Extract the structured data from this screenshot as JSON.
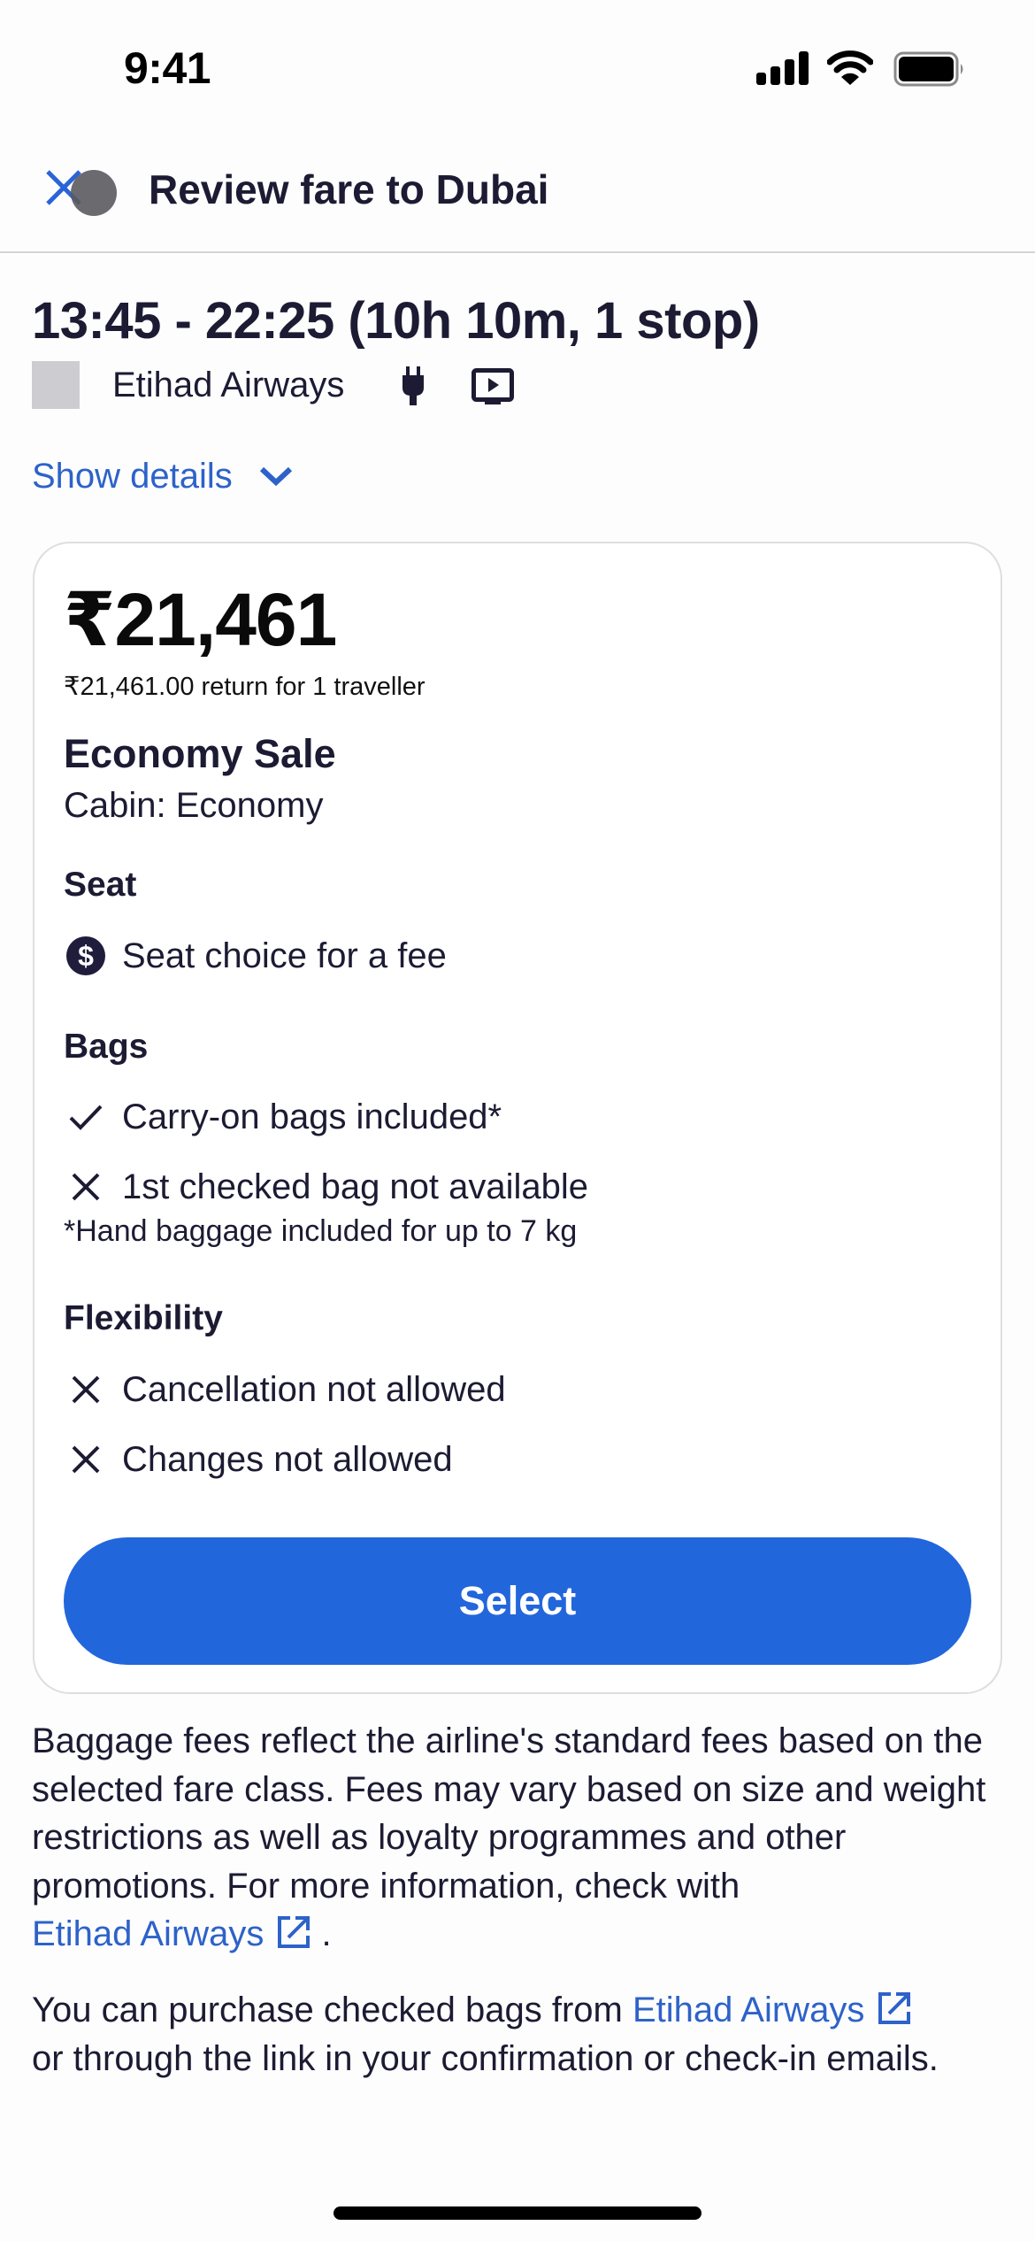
{
  "status_bar": {
    "time": "9:41",
    "icons": [
      "cellular-signal-icon",
      "wifi-icon",
      "battery-icon"
    ]
  },
  "header": {
    "close_icon": "close-icon",
    "title": "Review fare to Dubai"
  },
  "flight": {
    "times": "13:45 - 22:25 (10h 10m, 1 stop)",
    "airline": "Etihad Airways",
    "amenity_icons": [
      "power-plug-icon",
      "video-entertainment-icon"
    ],
    "show_details_label": "Show details"
  },
  "fare_card": {
    "price": "₹21,461",
    "price_detail": "₹21,461.00 return for 1 traveller",
    "fare_name": "Economy Sale",
    "cabin": "Cabin: Economy",
    "sections": {
      "seat": {
        "heading": "Seat",
        "items": [
          {
            "icon": "dollar-circle-icon",
            "label": "Seat choice for a fee"
          }
        ]
      },
      "bags": {
        "heading": "Bags",
        "items": [
          {
            "icon": "check-icon",
            "label": "Carry-on bags included*"
          },
          {
            "icon": "x-icon",
            "label": "1st checked bag not available"
          }
        ],
        "note": "*Hand baggage included for up to 7 kg"
      },
      "flexibility": {
        "heading": "Flexibility",
        "items": [
          {
            "icon": "x-icon",
            "label": "Cancellation not allowed"
          },
          {
            "icon": "x-icon",
            "label": "Changes not allowed"
          }
        ]
      }
    },
    "select_label": "Select"
  },
  "footer": {
    "para1_text": "Baggage fees reflect the airline's standard fees based on the selected fare class. Fees may vary based on size and weight restrictions as well as loyalty programmes and other promotions. For more information, check with",
    "para1_link": "Etihad Airways",
    "para1_end": ".",
    "para2_start": "You can purchase checked bags from",
    "para2_link": "Etihad Airways",
    "para2_end": "or through the link in your confirmation or check-in emails."
  },
  "colors": {
    "accent_blue": "#2266dc",
    "link_blue": "#2d62c9",
    "text_dark": "#1c1b33"
  }
}
